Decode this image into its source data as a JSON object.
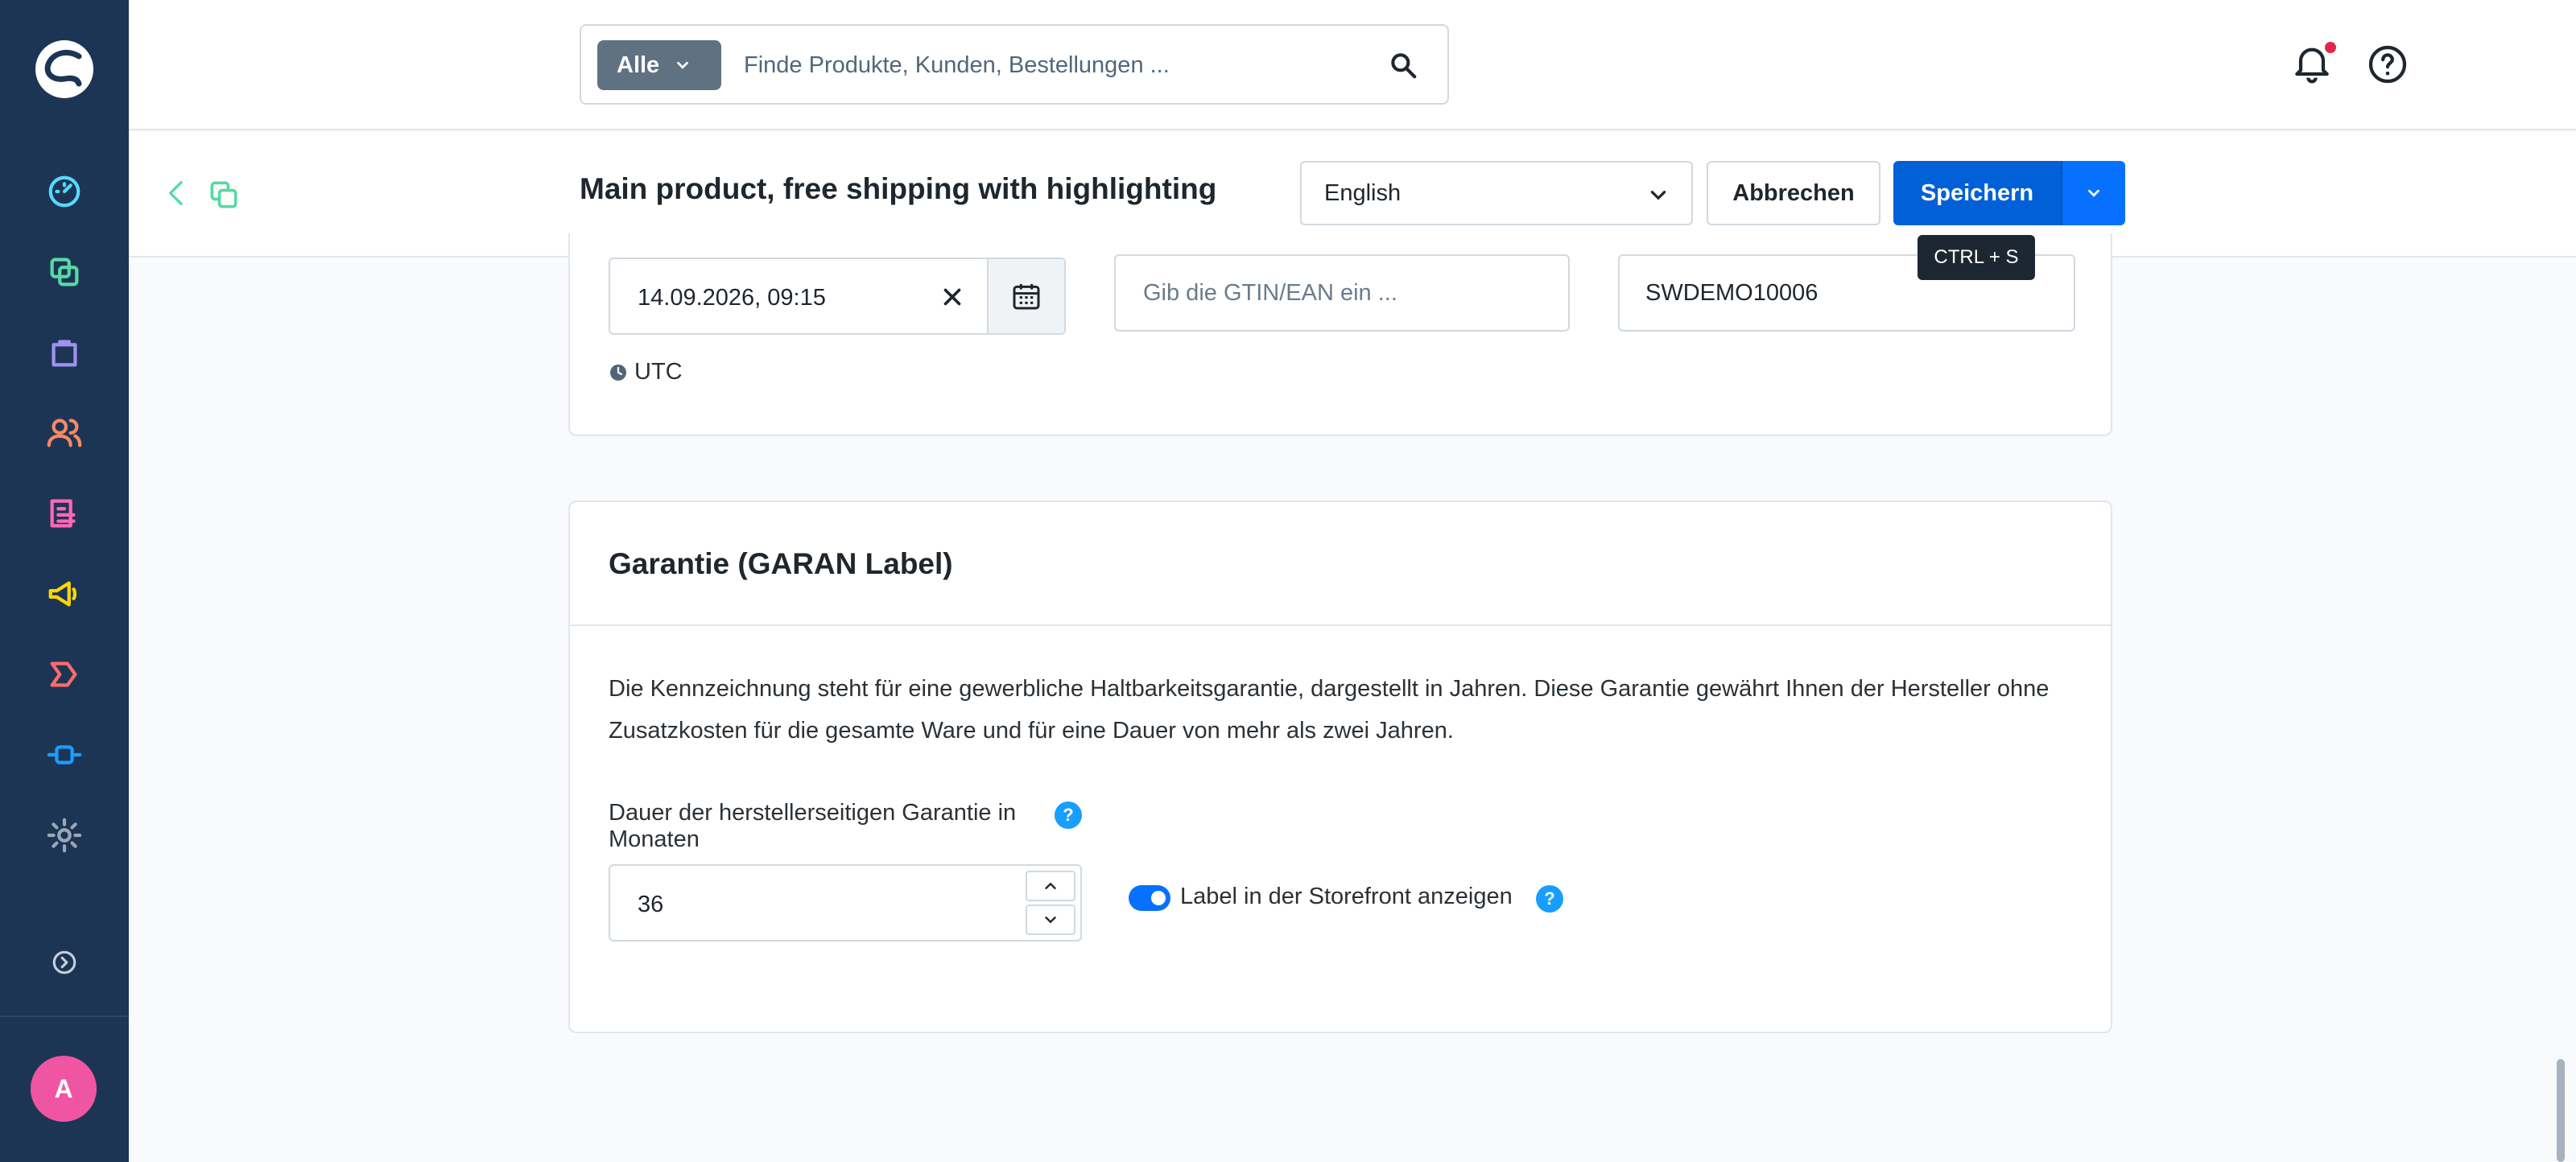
{
  "sidebar": {
    "nav": [
      {
        "name": "dashboard",
        "icon": "gauge-icon",
        "color": "#57d9ff"
      },
      {
        "name": "catalogues",
        "icon": "catalogue-icon",
        "color": "#57d9a3"
      },
      {
        "name": "orders",
        "icon": "shopping-bag-icon",
        "color": "#a092f0"
      },
      {
        "name": "customers",
        "icon": "users-icon",
        "color": "#f88962"
      },
      {
        "name": "content",
        "icon": "content-icon",
        "color": "#ff68b4"
      },
      {
        "name": "marketing",
        "icon": "megaphone-icon",
        "color": "#ffd700"
      },
      {
        "name": "flow",
        "icon": "flow-icon",
        "color": "#ff6b6b"
      },
      {
        "name": "extensions",
        "icon": "plug-icon",
        "color": "#189eff"
      },
      {
        "name": "settings",
        "icon": "gear-icon",
        "color": "#9aa8b5"
      }
    ],
    "avatar_initial": "A"
  },
  "header": {
    "search_type": "Alle",
    "search_placeholder": "Finde Produkte, Kunden, Bestellungen ..."
  },
  "smartbar": {
    "title": "Main product, free shipping with highlighting",
    "language": "English",
    "cancel_label": "Abbrechen",
    "save_label": "Speichern",
    "save_shortcut": "CTRL + S"
  },
  "top_card": {
    "release_date": "14.09.2026, 09:15",
    "timezone": "UTC",
    "gtin_placeholder": "Gib die GTIN/EAN ein ...",
    "product_number": "SWDEMO10006"
  },
  "garantie_card": {
    "title": "Garantie (GARAN Label)",
    "description": "Die Kennzeichnung steht für eine gewerbliche Haltbarkeitsgarantie, dargestellt in Jahren. Diese Garantie gewährt Ihnen der Hersteller ohne Zusatzkosten für die gesamte Ware und für eine Dauer von mehr als zwei Jahren.",
    "duration_label": "Dauer der herstellerseitigen Garantie in Monaten",
    "duration_value": "36",
    "show_label_text": "Label in der Storefront anzeigen",
    "show_label_enabled": true
  }
}
